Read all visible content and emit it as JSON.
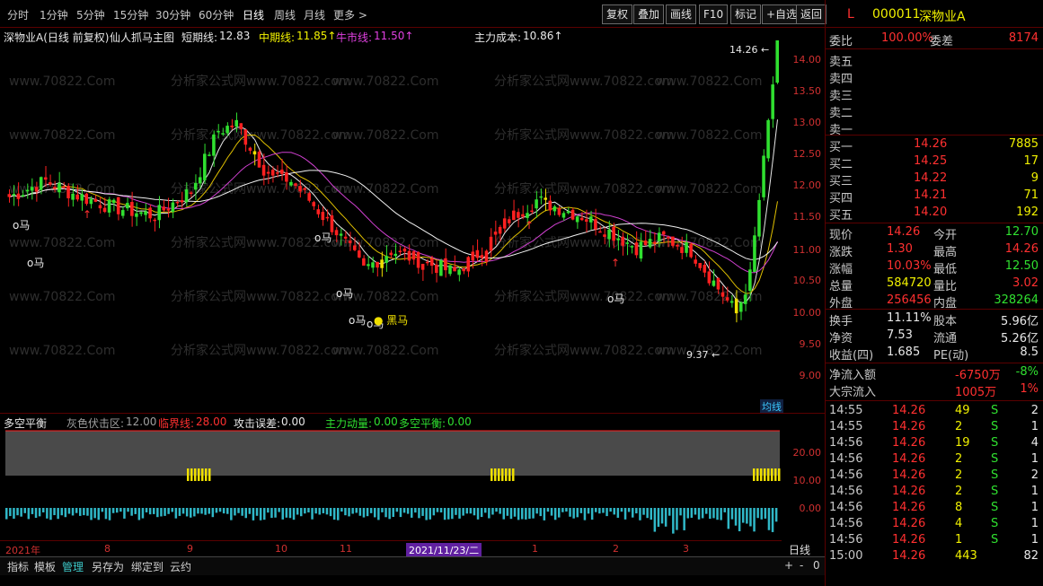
{
  "toolbar": {
    "periods": [
      "分时",
      "1分钟",
      "5分钟",
      "15分钟",
      "30分钟",
      "60分钟",
      "日线",
      "周线",
      "月线",
      "更多 >"
    ],
    "active_period": 6,
    "buttons": [
      "复权",
      "叠加",
      "画线",
      "F10",
      "标记",
      "+自选",
      "返回"
    ]
  },
  "info": {
    "stock_name": "深物业A(日线 前复权)",
    "indicator_name": "仙人抓马主图",
    "short_label": "短期线:",
    "short_value": "12.83",
    "mid_label": "中期线:",
    "mid_value": "11.85↑",
    "bull_label": "牛市线:",
    "bull_value": "11.50↑",
    "cost_label": "主力成本:",
    "cost_value": "10.86↑"
  },
  "main_chart": {
    "high_label": "14.26",
    "low_label": "9.37",
    "y_ticks": [
      "14.00",
      "13.50",
      "13.00",
      "12.50",
      "12.00",
      "11.50",
      "11.00",
      "10.50",
      "10.00",
      "9.50",
      "9.00"
    ],
    "ma_label": "均线",
    "horse_labels": [
      "马",
      "马",
      "马",
      "马",
      "马",
      "马",
      "黑马",
      "马"
    ],
    "colors": {
      "up": "#ff2020",
      "down": "#30e030",
      "flag": "#f0e000",
      "ma1": "#e8e8e8",
      "ma2": "#e0c000",
      "ma3": "#d040d0",
      "ma4": "#f0f0f0"
    },
    "watermark": [
      "www.70822.Com",
      "分析家公式网www.70822.com"
    ]
  },
  "indicator": {
    "name": "多空平衡",
    "gray_label": "灰色伏击区:",
    "gray_value": "12.00",
    "crit_label": "临界线:",
    "crit_value": "28.00",
    "attack_label": "攻击误差:",
    "attack_value": "0.00",
    "main_label": "主力动量:",
    "main_value": "0.00",
    "balance_label": "多空平衡:",
    "balance_value": "0.00",
    "y_ticks": [
      "20.00",
      "10.00",
      "0.00"
    ]
  },
  "date_axis": {
    "ticks": [
      "2021年",
      "8",
      "9",
      "10",
      "11",
      "1",
      "2",
      "3"
    ],
    "highlight": "2021/11/23/二",
    "label": "日线"
  },
  "bottom_tabs": {
    "tabs": [
      "指标",
      "模板",
      "管理",
      "另存为",
      "绑定到",
      "云约"
    ],
    "active": 2,
    "controls": [
      "+",
      "-",
      "0"
    ]
  },
  "right_panel": {
    "flag": "L",
    "code": "000011",
    "name": "深物业A",
    "wb_label": "委比",
    "wb_value": "100.00%",
    "wc_label": "委差",
    "wc_value": "8174",
    "sell": [
      "卖五",
      "卖四",
      "卖三",
      "卖二",
      "卖一"
    ],
    "buy": [
      {
        "label": "买一",
        "price": "14.26",
        "vol": "7885"
      },
      {
        "label": "买二",
        "price": "14.25",
        "vol": "17"
      },
      {
        "label": "买三",
        "price": "14.22",
        "vol": "9"
      },
      {
        "label": "买四",
        "price": "14.21",
        "vol": "71"
      },
      {
        "label": "买五",
        "price": "14.20",
        "vol": "192"
      }
    ],
    "stats": [
      {
        "l1": "现价",
        "v1": "14.26",
        "c1": "red",
        "l2": "今开",
        "v2": "12.70",
        "c2": "green"
      },
      {
        "l1": "涨跌",
        "v1": "1.30",
        "c1": "red",
        "l2": "最高",
        "v2": "14.26",
        "c2": "red"
      },
      {
        "l1": "涨幅",
        "v1": "10.03%",
        "c1": "red",
        "l2": "最低",
        "v2": "12.50",
        "c2": "green"
      },
      {
        "l1": "总量",
        "v1": "584720",
        "c1": "yellow",
        "l2": "量比",
        "v2": "3.02",
        "c2": "red"
      },
      {
        "l1": "外盘",
        "v1": "256456",
        "c1": "red",
        "l2": "内盘",
        "v2": "328264",
        "c2": "green"
      }
    ],
    "stats2": [
      {
        "l1": "换手",
        "v1": "11.11%",
        "l2": "股本",
        "v2": "5.96亿"
      },
      {
        "l1": "净资",
        "v1": "7.53",
        "l2": "流通",
        "v2": "5.26亿"
      },
      {
        "l1": "收益(四)",
        "v1": "1.685",
        "l2": "PE(动)",
        "v2": "8.5"
      }
    ],
    "flow": [
      {
        "label": "净流入额",
        "v1": "-6750万",
        "c1": "red",
        "v2": "-8%",
        "c2": "green"
      },
      {
        "label": "大宗流入",
        "v1": "1005万",
        "c1": "red",
        "v2": "1%",
        "c2": "red"
      }
    ],
    "ticks": [
      {
        "t": "14:55",
        "p": "14.26",
        "v": "49",
        "s": "S",
        "n": "2"
      },
      {
        "t": "14:55",
        "p": "14.26",
        "v": "2",
        "s": "S",
        "n": "1"
      },
      {
        "t": "14:56",
        "p": "14.26",
        "v": "19",
        "s": "S",
        "n": "4"
      },
      {
        "t": "14:56",
        "p": "14.26",
        "v": "2",
        "s": "S",
        "n": "1"
      },
      {
        "t": "14:56",
        "p": "14.26",
        "v": "2",
        "s": "S",
        "n": "2"
      },
      {
        "t": "14:56",
        "p": "14.26",
        "v": "2",
        "s": "S",
        "n": "1"
      },
      {
        "t": "14:56",
        "p": "14.26",
        "v": "8",
        "s": "S",
        "n": "1"
      },
      {
        "t": "14:56",
        "p": "14.26",
        "v": "4",
        "s": "S",
        "n": "1"
      },
      {
        "t": "14:56",
        "p": "14.26",
        "v": "1",
        "s": "S",
        "n": "1"
      },
      {
        "t": "15:00",
        "p": "14.26",
        "v": "443",
        "s": "",
        "n": "82"
      }
    ]
  }
}
